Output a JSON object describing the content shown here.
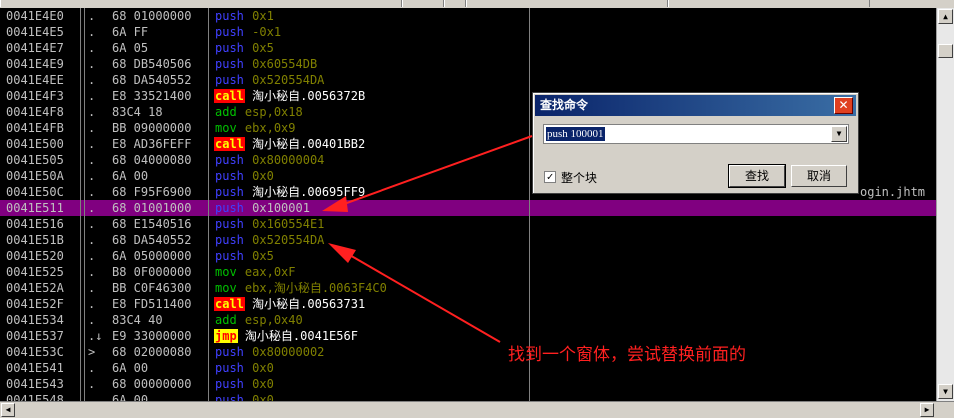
{
  "listing": {
    "rows": [
      {
        "addr": "0041E4E0",
        "mark": ".",
        "hex": "68 01000000",
        "mn": "push",
        "op": "0x1",
        "kind": "push",
        "cmt": ""
      },
      {
        "addr": "0041E4E5",
        "mark": ".",
        "hex": "6A FF",
        "mn": "push",
        "op": "-0x1",
        "kind": "push",
        "cmt": ""
      },
      {
        "addr": "0041E4E7",
        "mark": ".",
        "hex": "6A 05",
        "mn": "push",
        "op": "0x5",
        "kind": "push",
        "cmt": ""
      },
      {
        "addr": "0041E4E9",
        "mark": ".",
        "hex": "68 DB540506",
        "mn": "push",
        "op": "0x60554DB",
        "kind": "push",
        "cmt": ""
      },
      {
        "addr": "0041E4EE",
        "mark": ".",
        "hex": "68 DA540552",
        "mn": "push",
        "op": "0x520554DA",
        "kind": "push",
        "cmt": ""
      },
      {
        "addr": "0041E4F3",
        "mark": ".",
        "hex": "E8 33521400",
        "mn": "call",
        "op": "淘小秘自.0056372B",
        "kind": "call",
        "cmt": ""
      },
      {
        "addr": "0041E4F8",
        "mark": ".",
        "hex": "83C4 18",
        "mn": "add",
        "op": "esp,0x18",
        "kind": "add",
        "cmt": ""
      },
      {
        "addr": "0041E4FB",
        "mark": ".",
        "hex": "BB 09000000",
        "mn": "mov",
        "op": "ebx,0x9",
        "kind": "mov",
        "cmt": ""
      },
      {
        "addr": "0041E500",
        "mark": ".",
        "hex": "E8 AD36FEFF",
        "mn": "call",
        "op": "淘小秘自.00401BB2",
        "kind": "call",
        "cmt": ""
      },
      {
        "addr": "0041E505",
        "mark": ".",
        "hex": "68 04000080",
        "mn": "push",
        "op": "0x80000004",
        "kind": "push",
        "cmt": ""
      },
      {
        "addr": "0041E50A",
        "mark": ".",
        "hex": "6A 00",
        "mn": "push",
        "op": "0x0",
        "kind": "push",
        "cmt": ""
      },
      {
        "addr": "0041E50C",
        "mark": ".",
        "hex": "68 F95F6900",
        "mn": "push",
        "op": "淘小秘自.00695FF9",
        "kind": "call",
        "cmt": "ogin.jhtm"
      },
      {
        "addr": "0041E511",
        "mark": ".",
        "hex": "68 01001000",
        "mn": "push",
        "op": "0x100001",
        "kind": "push",
        "cmt": "",
        "sel": true
      },
      {
        "addr": "0041E516",
        "mark": ".",
        "hex": "68 E1540516",
        "mn": "push",
        "op": "0x160554E1",
        "kind": "push",
        "cmt": ""
      },
      {
        "addr": "0041E51B",
        "mark": ".",
        "hex": "68 DA540552",
        "mn": "push",
        "op": "0x520554DA",
        "kind": "push",
        "cmt": ""
      },
      {
        "addr": "0041E520",
        "mark": ".",
        "hex": "6A 05000000",
        "mn": "push",
        "op": "0x5",
        "kind": "push",
        "cmt": ""
      },
      {
        "addr": "0041E525",
        "mark": ".",
        "hex": "B8 0F000000",
        "mn": "mov",
        "op": "eax,0xF",
        "kind": "mov",
        "cmt": ""
      },
      {
        "addr": "0041E52A",
        "mark": ".",
        "hex": "BB C0F46300",
        "mn": "mov",
        "op": "ebx,淘小秘自.0063F4C0",
        "kind": "mov",
        "cmt": ""
      },
      {
        "addr": "0041E52F",
        "mark": ".",
        "hex": "E8 FD511400",
        "mn": "call",
        "op": "淘小秘自.00563731",
        "kind": "call",
        "cmt": ""
      },
      {
        "addr": "0041E534",
        "mark": ".",
        "hex": "83C4 40",
        "mn": "add",
        "op": "esp,0x40",
        "kind": "add",
        "cmt": ""
      },
      {
        "addr": "0041E537",
        "mark": ".↓",
        "hex": "E9 33000000",
        "mn": "jmp",
        "op": "淘小秘自.0041E56F",
        "kind": "jmp",
        "cmt": ""
      },
      {
        "addr": "0041E53C",
        "mark": ">",
        "hex": "68 02000080",
        "mn": "push",
        "op": "0x80000002",
        "kind": "push",
        "cmt": ""
      },
      {
        "addr": "0041E541",
        "mark": ".",
        "hex": "6A 00",
        "mn": "push",
        "op": "0x0",
        "kind": "push",
        "cmt": ""
      },
      {
        "addr": "0041E543",
        "mark": ".",
        "hex": "68 00000000",
        "mn": "push",
        "op": "0x0",
        "kind": "push",
        "cmt": ""
      },
      {
        "addr": "0041E548",
        "mark": ".",
        "hex": "6A 00",
        "mn": "push",
        "op": "0x0",
        "kind": "push",
        "cmt": ""
      }
    ]
  },
  "dialog": {
    "title": "查找命令",
    "close_label": "✕",
    "input_value": "push 100001",
    "checkbox_label": "整个块",
    "checkbox_checked": true,
    "find_label": "查找",
    "cancel_label": "取消"
  },
  "annotation": "找到一个窗体，尝试替换前面的",
  "colors": {
    "selection": "#800080",
    "arrow": "#ff2020"
  }
}
